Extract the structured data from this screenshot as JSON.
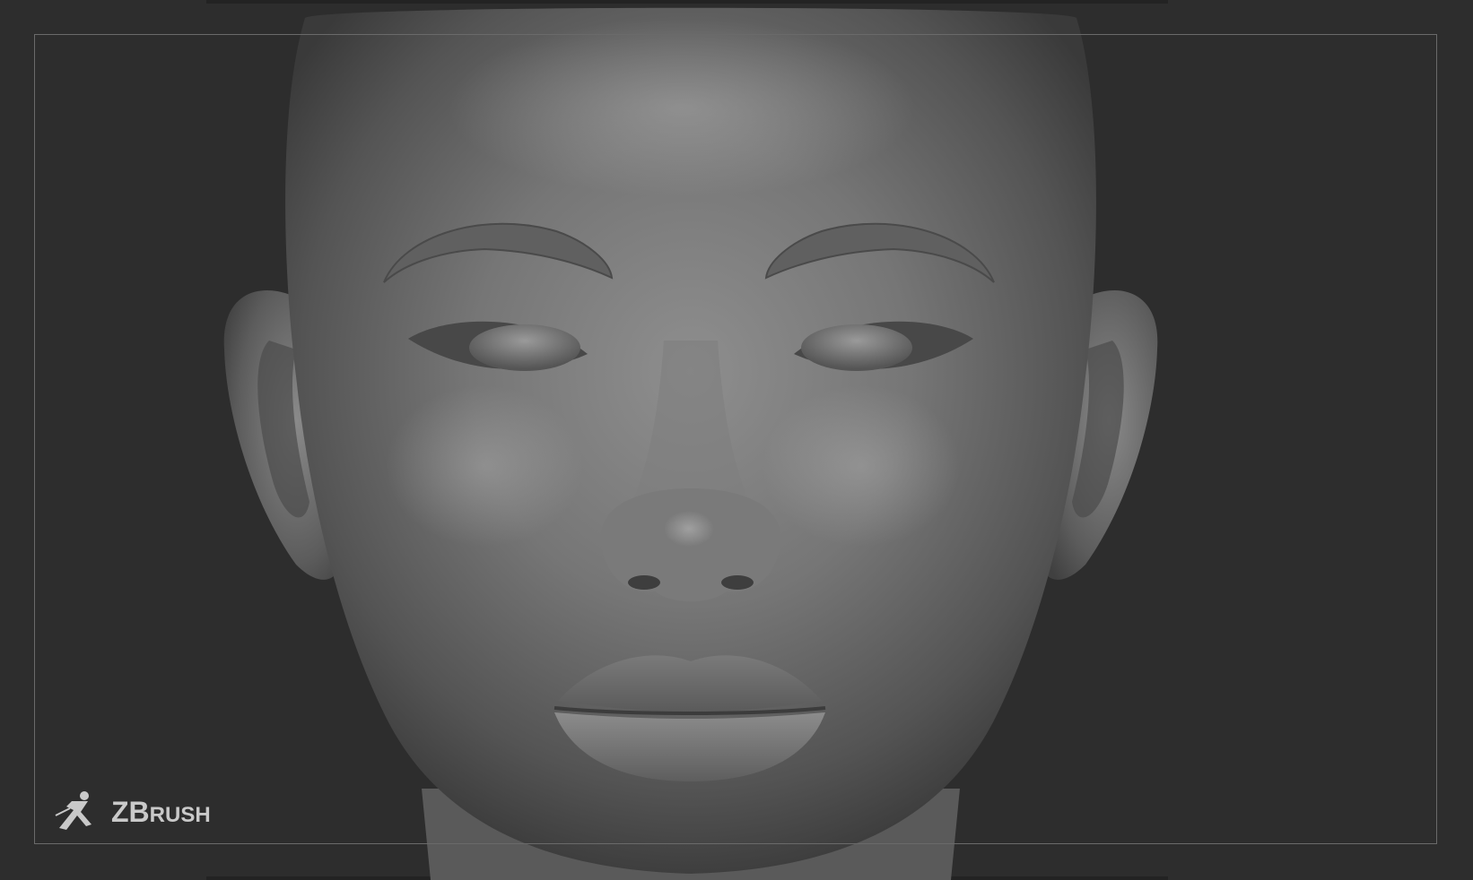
{
  "app": {
    "logo_text_big": "ZB",
    "logo_text_small": "RUSH"
  },
  "viewport": {
    "background": "#2d2d2d",
    "frame_color": "#6a6a6a",
    "subject": "head-sculpt"
  },
  "icons": {
    "logo_figure": "zbrush-figure-icon"
  }
}
